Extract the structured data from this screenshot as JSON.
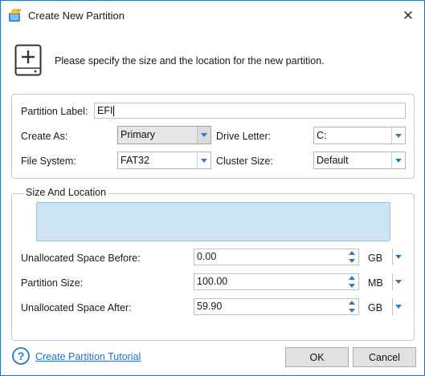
{
  "window": {
    "title": "Create New Partition",
    "close_glyph": "✕",
    "app_icon": "partition-wizard-icon"
  },
  "header": {
    "icon": "add-disk-icon",
    "instruction": "Please specify the size and the location for the new partition."
  },
  "form": {
    "partition_label": {
      "label": "Partition Label:",
      "value": "EFI"
    },
    "create_as": {
      "label": "Create As:",
      "value": "Primary"
    },
    "drive_letter": {
      "label": "Drive Letter:",
      "value": "C:"
    },
    "file_system": {
      "label": "File System:",
      "value": "FAT32"
    },
    "cluster_size": {
      "label": "Cluster Size:",
      "value": "Default"
    }
  },
  "size_location": {
    "legend": "Size And Location",
    "unallocated_before": {
      "label": "Unallocated Space Before:",
      "value": "0.00",
      "unit": "GB"
    },
    "partition_size": {
      "label": "Partition Size:",
      "value": "100.00",
      "unit": "MB"
    },
    "unallocated_after": {
      "label": "Unallocated Space After:",
      "value": "59.90",
      "unit": "GB"
    }
  },
  "footer": {
    "help_icon": "help-question-icon",
    "tutorial_link": "Create Partition Tutorial",
    "ok_label": "OK",
    "cancel_label": "Cancel"
  },
  "colors": {
    "accent": "#2b79c7",
    "link": "#2a6fbf",
    "disk_bar": "#cde3f1"
  }
}
